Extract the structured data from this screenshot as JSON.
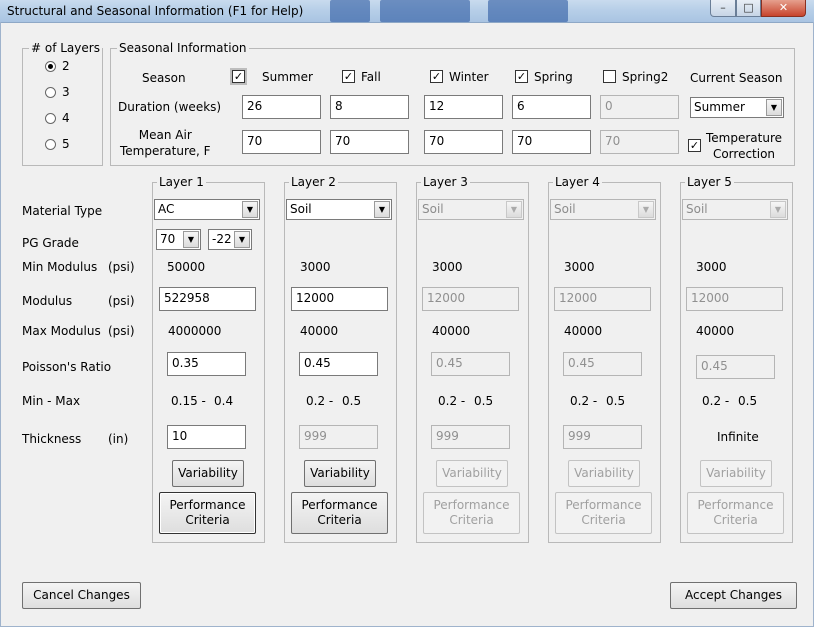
{
  "window": {
    "title": "Structural and Seasonal Information   (F1 for Help)",
    "minimize": "–",
    "maximize": "□",
    "close": "✕"
  },
  "layers_group": {
    "legend": "# of Layers",
    "options": [
      "2",
      "3",
      "4",
      "5"
    ],
    "selected": "2"
  },
  "seasonal": {
    "legend": "Seasonal Information",
    "season_label": "Season",
    "duration_label": "Duration (weeks)",
    "temp_label": "Mean Air\nTemperature, F",
    "current_season_label": "Current Season",
    "current_season_value": "Summer",
    "temp_correction_label": "Temperature\nCorrection",
    "temp_correction_checked": true,
    "seasons": [
      {
        "name": "Summer",
        "checked": true,
        "duration": "26",
        "temp": "70",
        "enabled": true
      },
      {
        "name": "Fall",
        "checked": true,
        "duration": "8",
        "temp": "70",
        "enabled": true
      },
      {
        "name": "Winter",
        "checked": true,
        "duration": "12",
        "temp": "70",
        "enabled": true
      },
      {
        "name": "Spring",
        "checked": true,
        "duration": "6",
        "temp": "70",
        "enabled": true
      },
      {
        "name": "Spring2",
        "checked": false,
        "duration": "0",
        "temp": "70",
        "enabled": false
      }
    ]
  },
  "row_labels": {
    "material_type": "Material Type",
    "pg_grade": "PG Grade",
    "min_modulus": "Min Modulus",
    "modulus": "Modulus",
    "max_modulus": "Max Modulus",
    "psi": "(psi)",
    "poisson": "Poisson's Ratio",
    "min_max": "Min - Max",
    "thickness": "Thickness",
    "inch": "(in)"
  },
  "pg_grade": {
    "high": "70",
    "low": "-22"
  },
  "variability_label": "Variability",
  "performance_label": "Performance\nCriteria",
  "layers": [
    {
      "title": "Layer 1",
      "material": "AC",
      "min_modulus": "50000",
      "modulus": "522958",
      "max_modulus": "4000000",
      "poisson": "0.35",
      "minmax_lo": "0.15 -",
      "minmax_hi": "0.4",
      "thickness": "10",
      "enabled": true
    },
    {
      "title": "Layer 2",
      "material": "Soil",
      "min_modulus": "3000",
      "modulus": "12000",
      "max_modulus": "40000",
      "poisson": "0.45",
      "minmax_lo": "0.2 -",
      "minmax_hi": "0.5",
      "thickness": "999",
      "enabled": true
    },
    {
      "title": "Layer 3",
      "material": "Soil",
      "min_modulus": "3000",
      "modulus": "12000",
      "max_modulus": "40000",
      "poisson": "0.45",
      "minmax_lo": "0.2  -",
      "minmax_hi": "0.5",
      "thickness": "999",
      "enabled": false
    },
    {
      "title": "Layer 4",
      "material": "Soil",
      "min_modulus": "3000",
      "modulus": "12000",
      "max_modulus": "40000",
      "poisson": "0.45",
      "minmax_lo": "0.2  -",
      "minmax_hi": "0.5",
      "thickness": "999",
      "enabled": false
    },
    {
      "title": "Layer 5",
      "material": "Soil",
      "min_modulus": "3000",
      "modulus": "12000",
      "max_modulus": "40000",
      "poisson": "0.45",
      "minmax_lo": "0.2  -",
      "minmax_hi": "0.5",
      "thickness": "Infinite",
      "enabled": false
    }
  ],
  "footer": {
    "cancel": "Cancel Changes",
    "accept": "Accept Changes"
  }
}
